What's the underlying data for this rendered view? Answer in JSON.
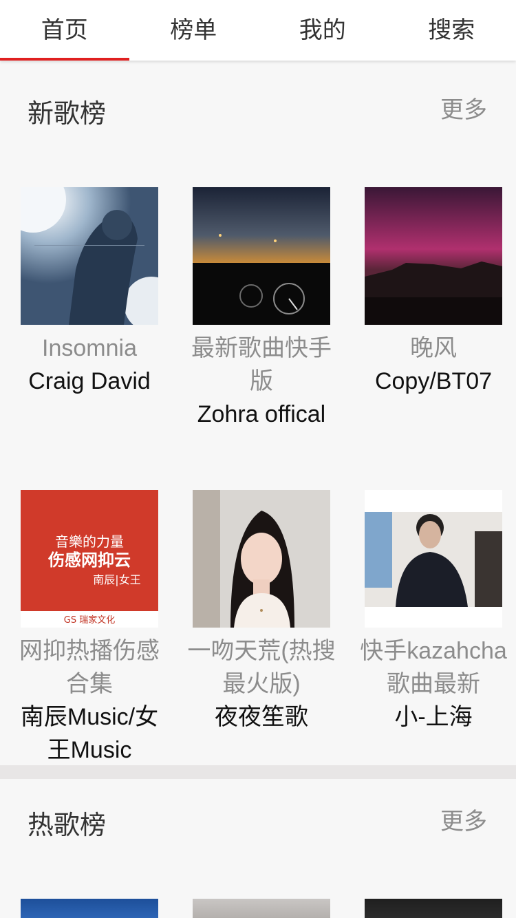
{
  "tabs": [
    {
      "label": "首页",
      "active": true
    },
    {
      "label": "榜单",
      "active": false
    },
    {
      "label": "我的",
      "active": false
    },
    {
      "label": "搜索",
      "active": false
    }
  ],
  "accent_color": "#e02020",
  "new_songs": {
    "title": "新歌榜",
    "more": "更多",
    "items": [
      {
        "song": "Insomnia",
        "artist": "Craig David"
      },
      {
        "song": "最新歌曲快手版",
        "artist": "Zohra offical"
      },
      {
        "song": "晚风",
        "artist": "Copy/BT07"
      },
      {
        "song": "网抑热播伤感合集",
        "artist": "南辰Music/女王Music",
        "cover_text": [
          "音樂的力量",
          "伤感网抑云",
          "南辰|女王",
          "GS 瑞家文化"
        ]
      },
      {
        "song": "一吻天荒(热搜最火版)",
        "artist": "夜夜笙歌"
      },
      {
        "song": "快手kazahcha歌曲最新",
        "artist": "小-上海"
      }
    ]
  },
  "hot_songs": {
    "title": "热歌榜",
    "more": "更多"
  }
}
